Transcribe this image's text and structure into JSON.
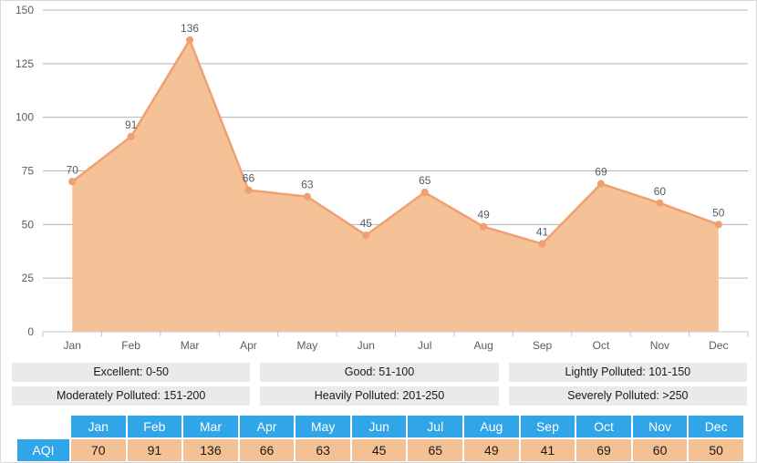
{
  "chart_data": {
    "type": "area",
    "title": "",
    "xlabel": "",
    "ylabel": "",
    "categories": [
      "Jan",
      "Feb",
      "Mar",
      "Apr",
      "May",
      "Jun",
      "Jul",
      "Aug",
      "Sep",
      "Oct",
      "Nov",
      "Dec"
    ],
    "series": [
      {
        "name": "AQI",
        "values": [
          70,
          91,
          136,
          66,
          63,
          45,
          65,
          49,
          41,
          69,
          60,
          50
        ]
      }
    ],
    "ylim": [
      0,
      150
    ],
    "yticks": [
      0,
      25,
      50,
      75,
      100,
      125,
      150
    ],
    "grid": true,
    "legend_position": "below-chart",
    "line_color": "#f0a070",
    "area_color": "#f5c196",
    "marker_color": "#f0a070",
    "data_labels": [
      "70",
      "91",
      "136",
      "66",
      "63",
      "45",
      "65",
      "49",
      "41",
      "69",
      "60",
      "50"
    ]
  },
  "axis": {
    "y_tick_labels": [
      "150",
      "125",
      "100",
      "75",
      "50",
      "25",
      "0"
    ],
    "x_tick_labels": [
      "Jan",
      "Feb",
      "Mar",
      "Apr",
      "May",
      "Jun",
      "Jul",
      "Aug",
      "Sep",
      "Oct",
      "Nov",
      "Dec"
    ]
  },
  "legend": {
    "rows": [
      [
        {
          "label": "Excellent: 0-50"
        },
        {
          "label": "Good: 51-100"
        },
        {
          "label": "Lightly Polluted: 101-150"
        }
      ],
      [
        {
          "label": "Moderately Polluted: 151-200"
        },
        {
          "label": "Heavily Polluted: 201-250"
        },
        {
          "label": "Severely Polluted: >250"
        }
      ]
    ]
  },
  "table": {
    "corner": "",
    "row_header": "AQI",
    "columns": [
      "Jan",
      "Feb",
      "Mar",
      "Apr",
      "May",
      "Jun",
      "Jul",
      "Aug",
      "Sep",
      "Oct",
      "Nov",
      "Dec"
    ],
    "values": [
      "70",
      "91",
      "136",
      "66",
      "63",
      "45",
      "65",
      "49",
      "41",
      "69",
      "60",
      "50"
    ]
  },
  "colors": {
    "header_blue": "#30a5e8",
    "cell_orange": "#f3c193",
    "legend_gray": "#eaeaea",
    "accent": "#f0a070"
  }
}
